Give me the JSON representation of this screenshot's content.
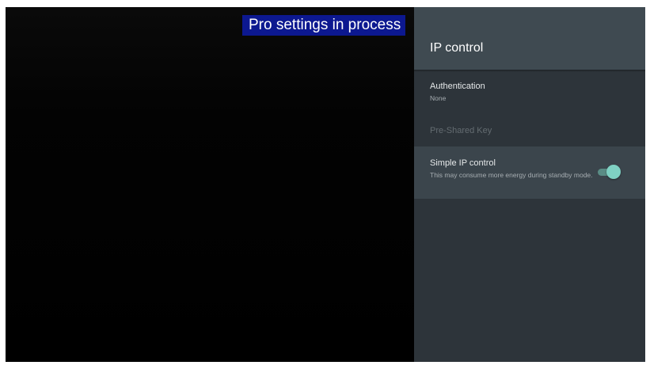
{
  "banner": {
    "text": "Pro settings in process"
  },
  "panel": {
    "title": "IP control",
    "items": [
      {
        "title": "Authentication",
        "subtitle": "None",
        "enabled": true
      },
      {
        "title": "Pre-Shared Key",
        "enabled": false
      },
      {
        "title": "Simple IP control",
        "subtitle": "This may consume more energy during standby mode.",
        "toggle": "on",
        "focused": true
      }
    ]
  },
  "colors": {
    "panel_bg": "#2d343a",
    "header_bg": "#3f4a51",
    "focused_row_bg": "#3b454c",
    "toggle_accent": "#7fd1c3",
    "banner_bg": "#0c1890"
  },
  "icons": {
    "toggle": "toggle-switch-on-icon"
  }
}
